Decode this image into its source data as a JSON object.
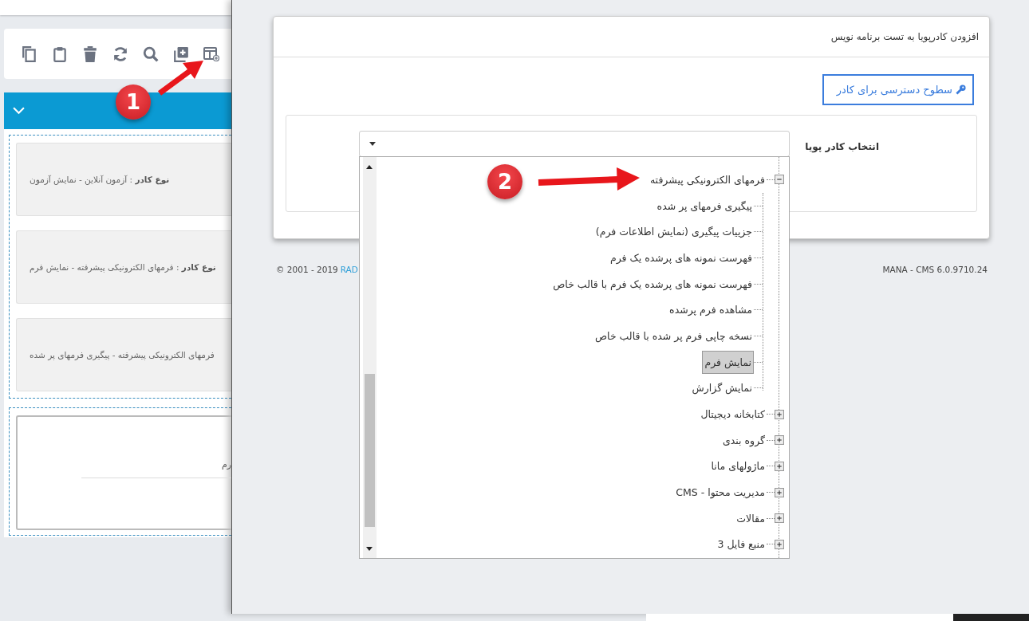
{
  "left_panel": {
    "cards": [
      {
        "text": "**نوع کادر** : آزمون آنلاین - نمایش آزمون"
      },
      {
        "text": "**نوع کادر** : فرمهای الکترونیکی پیشرفته - نمایش فرم"
      },
      {
        "text": "فرمهای الکترونیکی پیشرفته - پیگیری فرمهای پر شده"
      }
    ],
    "second_card": {
      "text": "رم"
    }
  },
  "annotations": [
    {
      "number": "1"
    },
    {
      "number": "2"
    }
  ],
  "dialog": {
    "title": "افزودن کادرپویا به تست برنامه نویس",
    "access_button": "سطوح دسترسی برای کادر",
    "field_label": "انتخاب کادر پویا",
    "dropdown": {
      "items": [
        {
          "label": "فرمهای الکترونیکی پیشرفته",
          "expanded": true,
          "selected": false,
          "children": [
            {
              "label": "پیگیری فرمهای پر شده",
              "selected": false
            },
            {
              "label": "جزییات پیگیری (نمایش اطلاعات فرم)",
              "selected": false
            },
            {
              "label": "فهرست نمونه های پرشده یک فرم",
              "selected": false
            },
            {
              "label": "فهرست نمونه های پرشده یک فرم با قالب خاص",
              "selected": false
            },
            {
              "label": "مشاهده فرم پرشده",
              "selected": false
            },
            {
              "label": "نسخه چاپی فرم پر شده با قالب خاص",
              "selected": false
            },
            {
              "label": "نمایش فرم",
              "selected": true
            },
            {
              "label": "نمایش گزارش",
              "selected": false
            }
          ]
        },
        {
          "label": "کتابخانه دیجیتال",
          "expanded": false,
          "selected": false
        },
        {
          "label": "گروه بندی",
          "expanded": false,
          "selected": false
        },
        {
          "label": "ماژولهای مانا",
          "expanded": false,
          "selected": false
        },
        {
          "label": "مدیریت محتوا - CMS",
          "expanded": false,
          "selected": false
        },
        {
          "label": "مقالات",
          "expanded": false,
          "selected": false
        },
        {
          "label": "منبع فایل 3",
          "expanded": false,
          "selected": false
        }
      ]
    }
  },
  "footer": {
    "copyright": "© 2001 - 2019",
    "company_link": "RAD",
    "version": "MANA - CMS 6.0.9710.24"
  }
}
